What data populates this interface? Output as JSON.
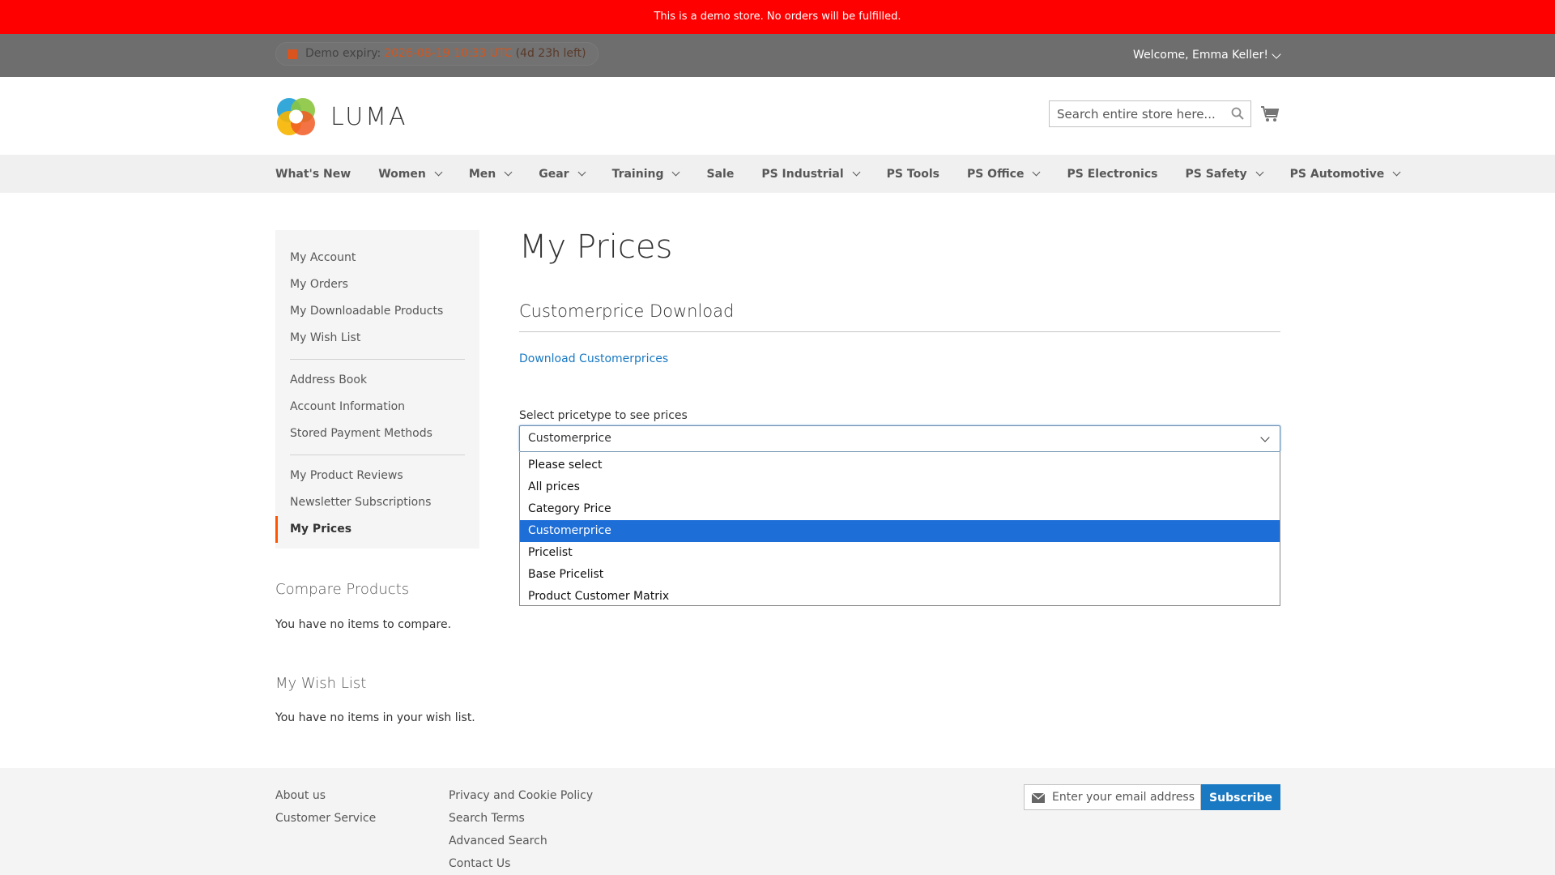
{
  "demo_notice": "This is a demo store. No orders will be fulfilled.",
  "panel": {
    "expiry_label": "Demo expiry:",
    "expiry_date": "2026-08-19 10:33 UTC",
    "expiry_left": "(4d 23h left)",
    "welcome": "Welcome, Emma Keller!"
  },
  "header": {
    "logo_text": "LUMA",
    "search_placeholder": "Search entire store here..."
  },
  "nav": {
    "items": [
      {
        "label": "What's New"
      },
      {
        "label": "Women"
      },
      {
        "label": "Men"
      },
      {
        "label": "Gear"
      },
      {
        "label": "Training"
      },
      {
        "label": "Sale"
      },
      {
        "label": "PS Industrial"
      },
      {
        "label": "PS Tools"
      },
      {
        "label": "PS Office"
      },
      {
        "label": "PS Electronics"
      },
      {
        "label": "PS Safety"
      },
      {
        "label": "PS Automotive"
      }
    ]
  },
  "sidebar": {
    "group1": [
      "My Account",
      "My Orders",
      "My Downloadable Products",
      "My Wish List"
    ],
    "group2": [
      "Address Book",
      "Account Information",
      "Stored Payment Methods"
    ],
    "group3": [
      "My Product Reviews",
      "Newsletter Subscriptions",
      "My Prices"
    ]
  },
  "compare": {
    "title": "Compare Products",
    "text": "You have no items to compare."
  },
  "wishlist": {
    "title": "My Wish List",
    "text": "You have no items in your wish list."
  },
  "main": {
    "page_title": "My Prices",
    "section_title": "Customerprice Download",
    "download_link": "Download Customerprices",
    "select_label": "Select pricetype to see prices",
    "select_value": "Customerprice",
    "options": [
      "Please select",
      "All prices",
      "Category Price",
      "Customerprice",
      "Pricelist",
      "Base Pricelist",
      "Product Customer Matrix"
    ]
  },
  "footer": {
    "col1": [
      "About us",
      "Customer Service"
    ],
    "col2": [
      "Privacy and Cookie Policy",
      "Search Terms",
      "Advanced Search",
      "Contact Us"
    ],
    "newsletter_placeholder": "Enter your email address",
    "subscribe": "Subscribe"
  }
}
